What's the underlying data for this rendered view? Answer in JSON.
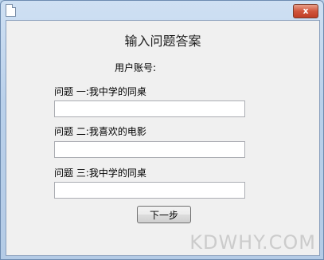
{
  "window": {
    "title": "",
    "close_label": "x"
  },
  "heading": "输入问题答案",
  "account": {
    "label": "用户账号:",
    "value": ""
  },
  "questions": [
    {
      "label": "问题 一:我中学的同桌",
      "value": ""
    },
    {
      "label": "问题 二:我喜欢的电影",
      "value": ""
    },
    {
      "label": "问题 三:我中学的同桌",
      "value": ""
    }
  ],
  "next_button": "下一步",
  "watermark": "KDWHY.COM"
}
